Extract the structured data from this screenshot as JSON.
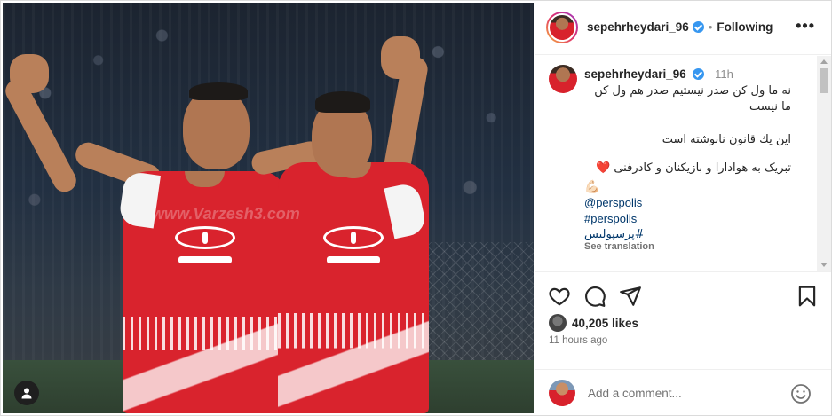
{
  "post": {
    "username": "sepehrheydari_96",
    "follow_status": "Following",
    "separator": "•",
    "more_label": "•••",
    "caption": {
      "time": "11h",
      "line1": "نه ما ول کن صدر نیستیم صدر هم ول کن ما نیست",
      "line2": "این یك قانون نانوشته است",
      "line3": "تبریک به هوادارا و بازیکنان و کادرفنی",
      "heart_emoji": "❤️",
      "muscle_emoji": "💪🏻",
      "mention": "@perspolis",
      "hashtag1": "#perspolis",
      "hashtag2": "#پرسپولیس",
      "see_translation": "See translation"
    },
    "likes": "40,205 likes",
    "posted_ago": "11 hours ago",
    "comment_placeholder": "Add a comment..."
  },
  "media": {
    "watermark": "www.Varzesh3.com"
  },
  "icons": {
    "like": "heart-outline-icon",
    "comment": "comment-bubble-icon",
    "share": "paper-plane-icon",
    "save": "bookmark-icon",
    "emoji": "smiley-icon",
    "verified": "verified-badge-icon",
    "tagged_user": "user-icon"
  },
  "colors": {
    "link": "#00376b",
    "verified": "#3797f0",
    "muted": "#737373",
    "kit_red": "#d8222c"
  }
}
